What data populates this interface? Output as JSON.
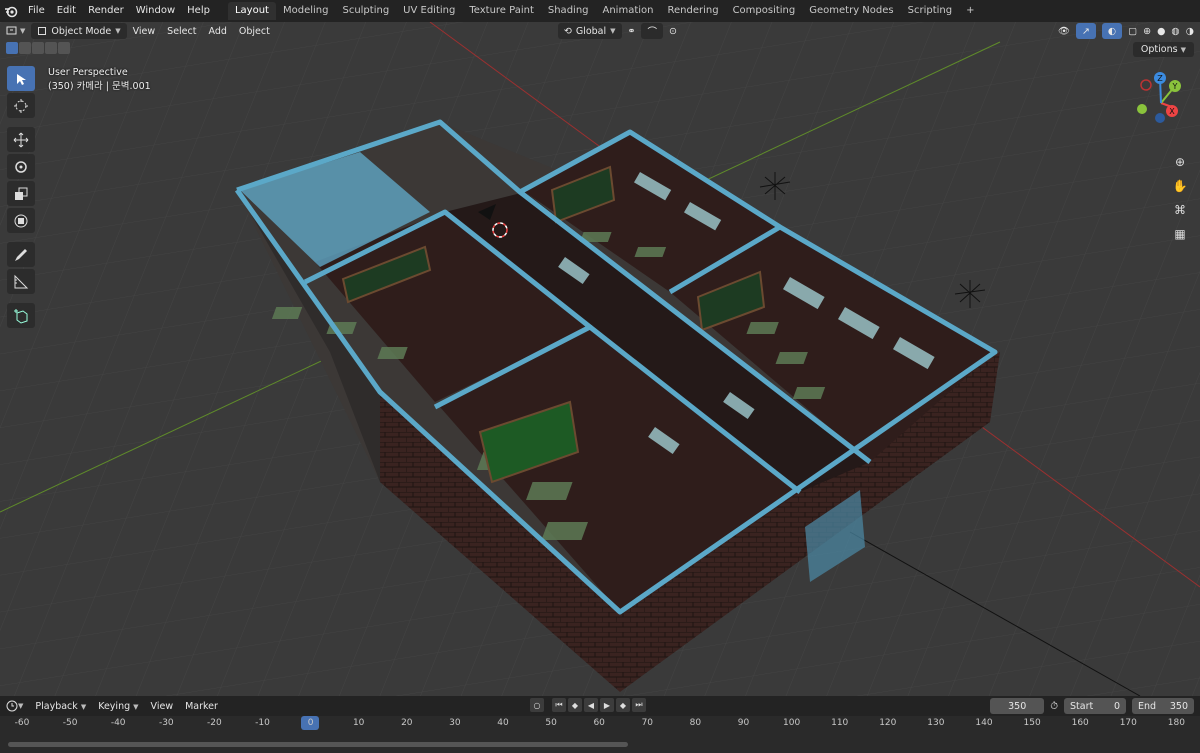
{
  "topbar": {
    "menus": [
      "File",
      "Edit",
      "Render",
      "Window",
      "Help"
    ],
    "tabs": [
      "Layout",
      "Modeling",
      "Sculpting",
      "UV Editing",
      "Texture Paint",
      "Shading",
      "Animation",
      "Rendering",
      "Compositing",
      "Geometry Nodes",
      "Scripting"
    ],
    "active_tab": "Layout",
    "add_tab": "+"
  },
  "viewport_header": {
    "mode": "Object Mode",
    "menus": [
      "View",
      "Select",
      "Add",
      "Object"
    ],
    "transform_orientation": "Global",
    "options": "Options"
  },
  "viewport_info": {
    "perspective": "User Perspective",
    "object": "(350) 카메라 | 문벽.001"
  },
  "gizmo": {
    "z": "Z",
    "y": "Y",
    "x": "X"
  },
  "timeline": {
    "menus": [
      "Playback",
      "Keying",
      "View",
      "Marker"
    ],
    "current_frame": "350",
    "start_label": "Start",
    "start_value": "0",
    "end_label": "End",
    "end_value": "350",
    "ruler": [
      "-60",
      "-50",
      "-40",
      "-30",
      "-20",
      "-10",
      "0",
      "10",
      "20",
      "30",
      "40",
      "50",
      "60",
      "70",
      "80",
      "90",
      "100",
      "110",
      "120",
      "130",
      "140",
      "150",
      "160",
      "170",
      "180"
    ]
  },
  "colors": {
    "accent": "#4772b3",
    "wall_top": "#5ba8c8",
    "grid": "#444444",
    "floor": "#3a2320"
  }
}
